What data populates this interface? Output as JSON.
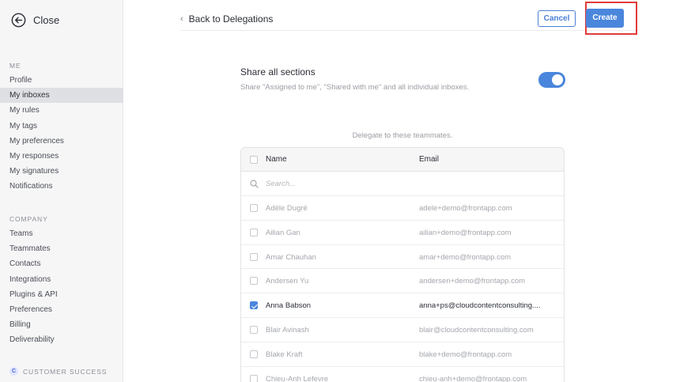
{
  "sidebar": {
    "close_label": "Close",
    "me_section": "ME",
    "me_items": [
      {
        "label": "Profile"
      },
      {
        "label": "My inboxes",
        "active": true
      },
      {
        "label": "My rules"
      },
      {
        "label": "My tags"
      },
      {
        "label": "My preferences"
      },
      {
        "label": "My responses"
      },
      {
        "label": "My signatures"
      },
      {
        "label": "Notifications"
      }
    ],
    "company_section": "COMPANY",
    "company_items": [
      {
        "label": "Teams"
      },
      {
        "label": "Teammates"
      },
      {
        "label": "Contacts"
      },
      {
        "label": "Integrations"
      },
      {
        "label": "Plugins & API"
      },
      {
        "label": "Preferences"
      },
      {
        "label": "Billing"
      },
      {
        "label": "Deliverability"
      }
    ],
    "customer_success": {
      "badge": "C",
      "label": "CUSTOMER SUCCESS"
    }
  },
  "header": {
    "back_label": "Back to Delegations",
    "cancel_label": "Cancel",
    "create_label": "Create"
  },
  "share": {
    "title": "Share all sections",
    "description": "Share \"Assigned to me\", \"Shared with me\" and all individual inboxes.",
    "enabled": true
  },
  "delegate_caption": "Delegate to these teammates.",
  "table": {
    "columns": {
      "name": "Name",
      "email": "Email"
    },
    "search_placeholder": "Search...",
    "rows": [
      {
        "name": "Adèle Dugré",
        "email": "adele+demo@frontapp.com",
        "checked": false
      },
      {
        "name": "Ailian Gan",
        "email": "ailian+demo@frontapp.com",
        "checked": false
      },
      {
        "name": "Amar Chauhan",
        "email": "amar+demo@frontapp.com",
        "checked": false
      },
      {
        "name": "Andersen Yu",
        "email": "andersen+demo@frontapp.com",
        "checked": false
      },
      {
        "name": "Anna Babson",
        "email": "anna+ps@cloudcontentconsulting....",
        "checked": true
      },
      {
        "name": "Blair Avinash",
        "email": "blair@cloudcontentconsulting.com",
        "checked": false
      },
      {
        "name": "Blake Kraft",
        "email": "blake+demo@frontapp.com",
        "checked": false
      },
      {
        "name": "Chieu-Anh Lefevre",
        "email": "chieu-anh+demo@frontapp.com",
        "checked": false
      }
    ]
  },
  "colors": {
    "accent": "#4a86dc",
    "highlight": "#e23b3b"
  },
  "icons": {
    "close": "circle-arrow-left-icon",
    "back": "chevron-left-icon",
    "search": "search-icon",
    "badge": "customer-success-badge"
  }
}
